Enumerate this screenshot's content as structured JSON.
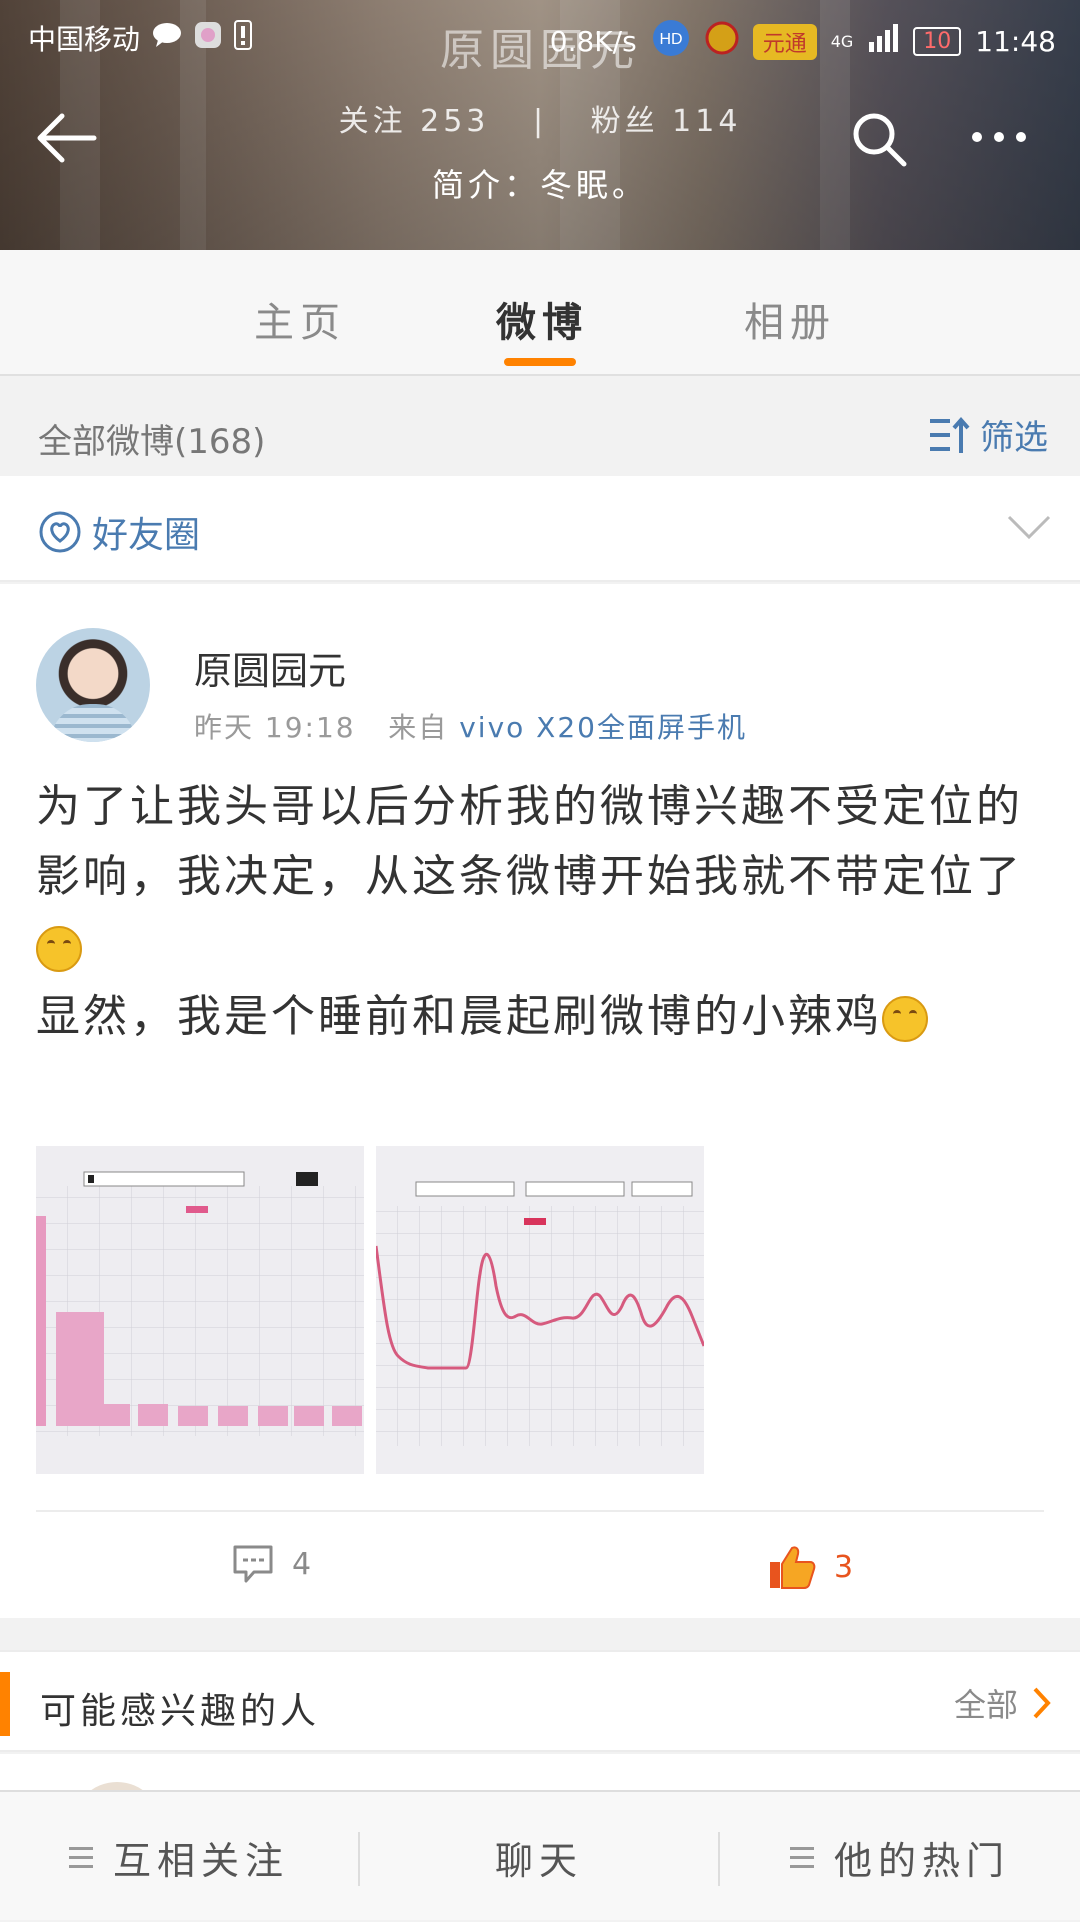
{
  "status_bar": {
    "carrier": "中国移动",
    "network_speed": "0.8K/s",
    "badge": "元通",
    "network_type": "4G",
    "battery": "10",
    "time": "11:48"
  },
  "header": {
    "title": "原圆园元",
    "follow_label": "关注",
    "follow_count": "253",
    "fans_label": "粉丝",
    "fans_count": "114",
    "bio": "简介：冬眠。"
  },
  "tabs": [
    {
      "label": "主页",
      "active": false
    },
    {
      "label": "微博",
      "active": true
    },
    {
      "label": "相册",
      "active": false
    }
  ],
  "filter_bar": {
    "count_label": "全部微博(168)",
    "filter_label": "筛选"
  },
  "circle": {
    "label": "好友圈"
  },
  "post": {
    "author": "原圆园元",
    "time": "昨天 19:18",
    "from_label": "来自",
    "source": "vivo X20全面屏手机",
    "text_lines": [
      "为了让我头哥以后分析我的微博兴趣不受定位的影响，我决定，从这条微博开始我就不带定位了",
      "显然，我是个睡前和晨起刷微博的小辣鸡"
    ],
    "comments": "4",
    "likes": "3"
  },
  "suggestions": {
    "title": "可能感兴趣的人",
    "all_label": "全部"
  },
  "bottom_bar": [
    {
      "label": "互相关注"
    },
    {
      "label": "聊天"
    },
    {
      "label": "他的热门"
    }
  ],
  "colors": {
    "accent": "#ff8200",
    "link": "#4a7bb0",
    "like": "#e8541e"
  }
}
